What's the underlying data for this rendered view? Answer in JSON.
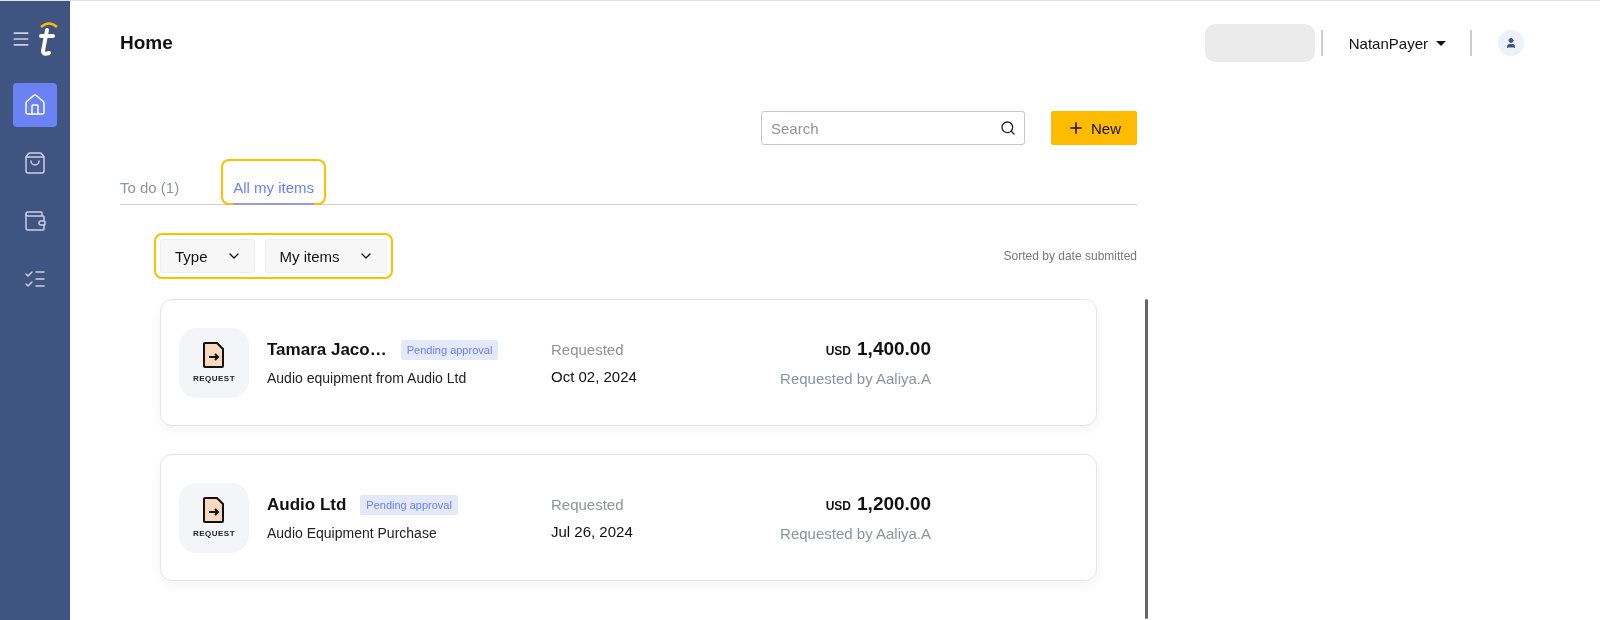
{
  "sidebar": {
    "items": [
      {
        "kind": "home",
        "selected": true
      },
      {
        "kind": "bag",
        "selected": false
      },
      {
        "kind": "wallet",
        "selected": false
      },
      {
        "kind": "checklist",
        "selected": false
      }
    ]
  },
  "header": {
    "title": "Home",
    "user": "NatanPayer"
  },
  "search": {
    "placeholder": "Search"
  },
  "new_button": "New",
  "tabs": [
    {
      "label": "To do (1)",
      "selected": false,
      "highlighted": false
    },
    {
      "label": "All my items",
      "selected": true,
      "highlighted": true
    }
  ],
  "filters": {
    "highlighted": true,
    "items": [
      "Type",
      "My items"
    ]
  },
  "sort_note": "Sorted by date submitted",
  "items": [
    {
      "icon_label": "REQUEST",
      "title": "Tamara Jaco…",
      "status": "Pending approval",
      "description": "Audio equipment from Audio Ltd",
      "date_label": "Requested",
      "date": "Oct 02, 2024",
      "currency": "USD",
      "amount": "1,400.00",
      "requester": "Requested by Aaliya.A"
    },
    {
      "icon_label": "REQUEST",
      "title": "Audio Ltd",
      "status": "Pending approval",
      "description": "Audio Equipment Purchase",
      "date_label": "Requested",
      "date": "Jul 26, 2024",
      "currency": "USD",
      "amount": "1,200.00",
      "requester": "Requested by Aaliya.A"
    }
  ]
}
